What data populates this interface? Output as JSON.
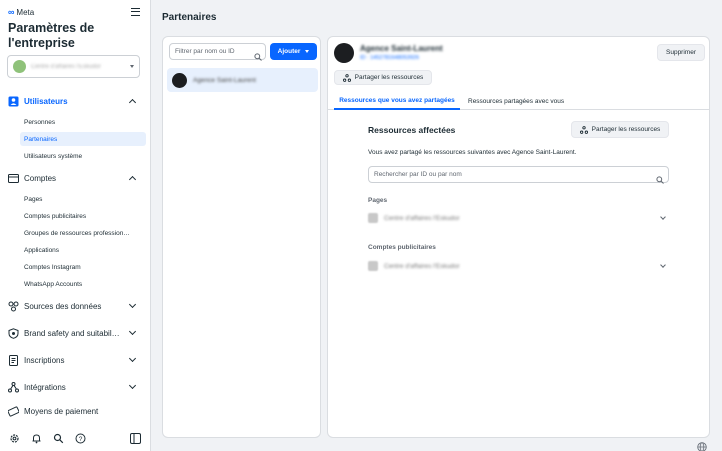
{
  "sidebar": {
    "brand": "Meta",
    "title": "Paramètres de l'entreprise",
    "business_selector": {
      "name": "Centre d'affaires l'Eskudor"
    },
    "sections": [
      {
        "label": "Utilisateurs",
        "icon": "users-icon",
        "expanded": true,
        "active": true,
        "items": [
          {
            "label": "Personnes",
            "active": false
          },
          {
            "label": "Partenaires",
            "active": true
          },
          {
            "label": "Utilisateurs système",
            "active": false
          }
        ]
      },
      {
        "label": "Comptes",
        "icon": "accounts-icon",
        "expanded": true,
        "active": false,
        "items": [
          {
            "label": "Pages"
          },
          {
            "label": "Comptes publicitaires"
          },
          {
            "label": "Groupes de ressources profession…"
          },
          {
            "label": "Applications"
          },
          {
            "label": "Comptes Instagram"
          },
          {
            "label": "WhatsApp Accounts"
          }
        ]
      },
      {
        "label": "Sources des données",
        "icon": "data-sources-icon",
        "expanded": false
      },
      {
        "label": "Brand safety and suitabil…",
        "icon": "shield-icon",
        "expanded": false
      },
      {
        "label": "Inscriptions",
        "icon": "registrations-icon",
        "expanded": false
      },
      {
        "label": "Intégrations",
        "icon": "integrations-icon",
        "expanded": false
      },
      {
        "label": "Moyens de paiement",
        "icon": "payment-icon"
      }
    ],
    "bottom_icons": [
      "gear-icon",
      "bell-icon",
      "search-icon",
      "help-icon",
      "panel-toggle-icon"
    ]
  },
  "main": {
    "page_title": "Partenaires",
    "list": {
      "filter_placeholder": "Filtrer par nom ou ID",
      "add_label": "Ajouter",
      "items": [
        {
          "name": "Agence Saint-Laurent",
          "selected": true
        }
      ]
    },
    "detail": {
      "partner_name": "Agence Saint-Laurent",
      "partner_id": "ID : 1452781648053926",
      "remove_label": "Supprimer",
      "share_label": "Partager les ressources",
      "tabs": [
        {
          "label": "Ressources que vous avez partagées",
          "active": true
        },
        {
          "label": "Ressources partagées avec vous",
          "active": false
        }
      ],
      "resources": {
        "title": "Ressources affectées",
        "share_label": "Partager les ressources",
        "description": "Vous avez partagé les ressources suivantes avec Agence Saint-Laurent.",
        "search_placeholder": "Rechercher par ID ou par nom",
        "groups": [
          {
            "label": "Pages",
            "item": "Centre d'affaires l'Eskudor"
          },
          {
            "label": "Comptes publicitaires",
            "item": "Centre d'affaires l'Eskudor"
          }
        ]
      }
    }
  },
  "colors": {
    "accent": "#0866ff",
    "active_bg": "#e7f0fd",
    "page_bg": "#f0f2f5",
    "text": "#1c2b33"
  }
}
